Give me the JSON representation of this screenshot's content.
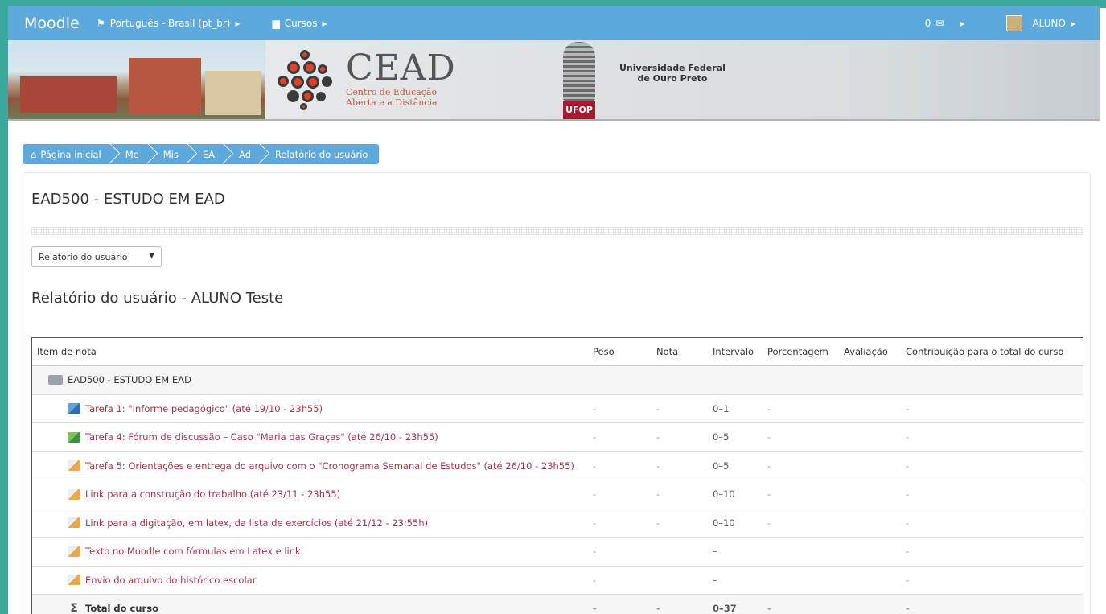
{
  "navbar": {
    "brand": "Moodle",
    "language": "Português - Brasil (pt_br)",
    "courses": "Cursos",
    "messages": "0",
    "user": "ALUNO"
  },
  "banner": {
    "cead_title": "CEAD",
    "cead_sub1": "Centro de Educação",
    "cead_sub2": "Aberta e a Distância",
    "crest_tag": "UFOP",
    "univ_line1": "Universidade Federal",
    "univ_line2": "de Ouro Preto"
  },
  "breadcrumb": [
    "Página inicial",
    "Me",
    "Mis",
    "EA",
    "Ad",
    "Relatório do usuário"
  ],
  "course_title": "EAD500 - ESTUDO EM EAD",
  "report_select": "Relatório do usuário",
  "report_title": "Relatório do usuário - ALUNO Teste",
  "table": {
    "headers": {
      "item": "Item de nota",
      "peso": "Peso",
      "nota": "Nota",
      "intervalo": "Intervalo",
      "porcentagem": "Porcentagem",
      "avaliacao": "Avaliação",
      "contribuicao": "Contribuição para o total do curso"
    },
    "category": "EAD500 - ESTUDO EM EAD",
    "rows": [
      {
        "icon": "assignment-icon",
        "item": "Tarefa 1: \"Informe pedagógico\" (até 19/10 - 23h55)",
        "peso": "-",
        "nota": "-",
        "intervalo": "0–1",
        "porcentagem": "-",
        "contribuicao": "-"
      },
      {
        "icon": "forum-icon",
        "item": "Tarefa 4: Fórum de discussão – Caso \"Maria das Graças\" (até 26/10 - 23h55)",
        "peso": "-",
        "nota": "-",
        "intervalo": "0–5",
        "porcentagem": "-",
        "contribuicao": "-"
      },
      {
        "icon": "upload-icon",
        "item": "Tarefa 5: Orientações e entrega do arquivo com o \"Cronograma Semanal de Estudos\" (até 26/10 - 23h55)",
        "peso": "-",
        "nota": "-",
        "intervalo": "0–5",
        "porcentagem": "-",
        "contribuicao": "-"
      },
      {
        "icon": "upload-icon",
        "item": "Link para a construção do trabalho (até 23/11 - 23h55)",
        "peso": "-",
        "nota": "-",
        "intervalo": "0–10",
        "porcentagem": "-",
        "contribuicao": "-"
      },
      {
        "icon": "upload-icon",
        "item": "Link para a digitação, em latex, da lista de exercícios (até 21/12 - 23:55h)",
        "peso": "-",
        "nota": "-",
        "intervalo": "0–10",
        "porcentagem": "-",
        "contribuicao": "-"
      },
      {
        "icon": "upload-icon",
        "item": "Texto no Moodle com fórmulas em Latex e link",
        "peso": "-",
        "nota": "",
        "intervalo": "–",
        "porcentagem": "",
        "contribuicao": "-"
      },
      {
        "icon": "upload-icon",
        "item": "Envio do arquivo do histórico escolar",
        "peso": "-",
        "nota": "",
        "intervalo": "–",
        "porcentagem": "",
        "contribuicao": "-"
      }
    ],
    "total": {
      "item": "Total do curso",
      "peso": "-",
      "nota": "-",
      "intervalo": "0–37",
      "porcentagem": "-",
      "contribuicao": "-"
    }
  }
}
